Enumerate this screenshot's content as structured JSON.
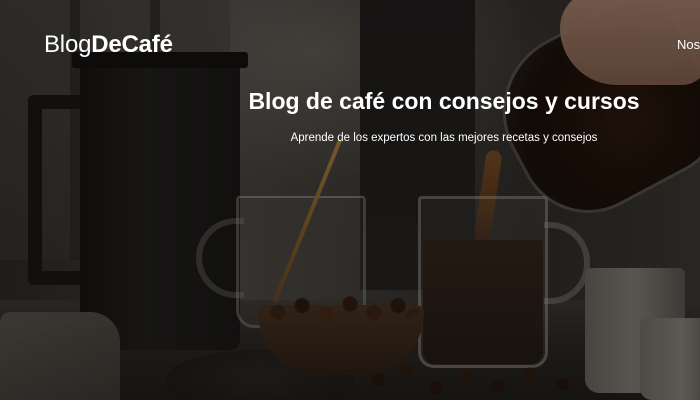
{
  "header": {
    "logo_light": "Blog",
    "logo_bold": "DeCafé",
    "nav_item": "Nos"
  },
  "hero": {
    "title": "Blog de café con consejos y cursos",
    "subtitle": "Aprende de los expertos con las mejores recetas y consejos"
  },
  "colors": {
    "text": "#ffffff",
    "overlay": "#0a0806"
  }
}
